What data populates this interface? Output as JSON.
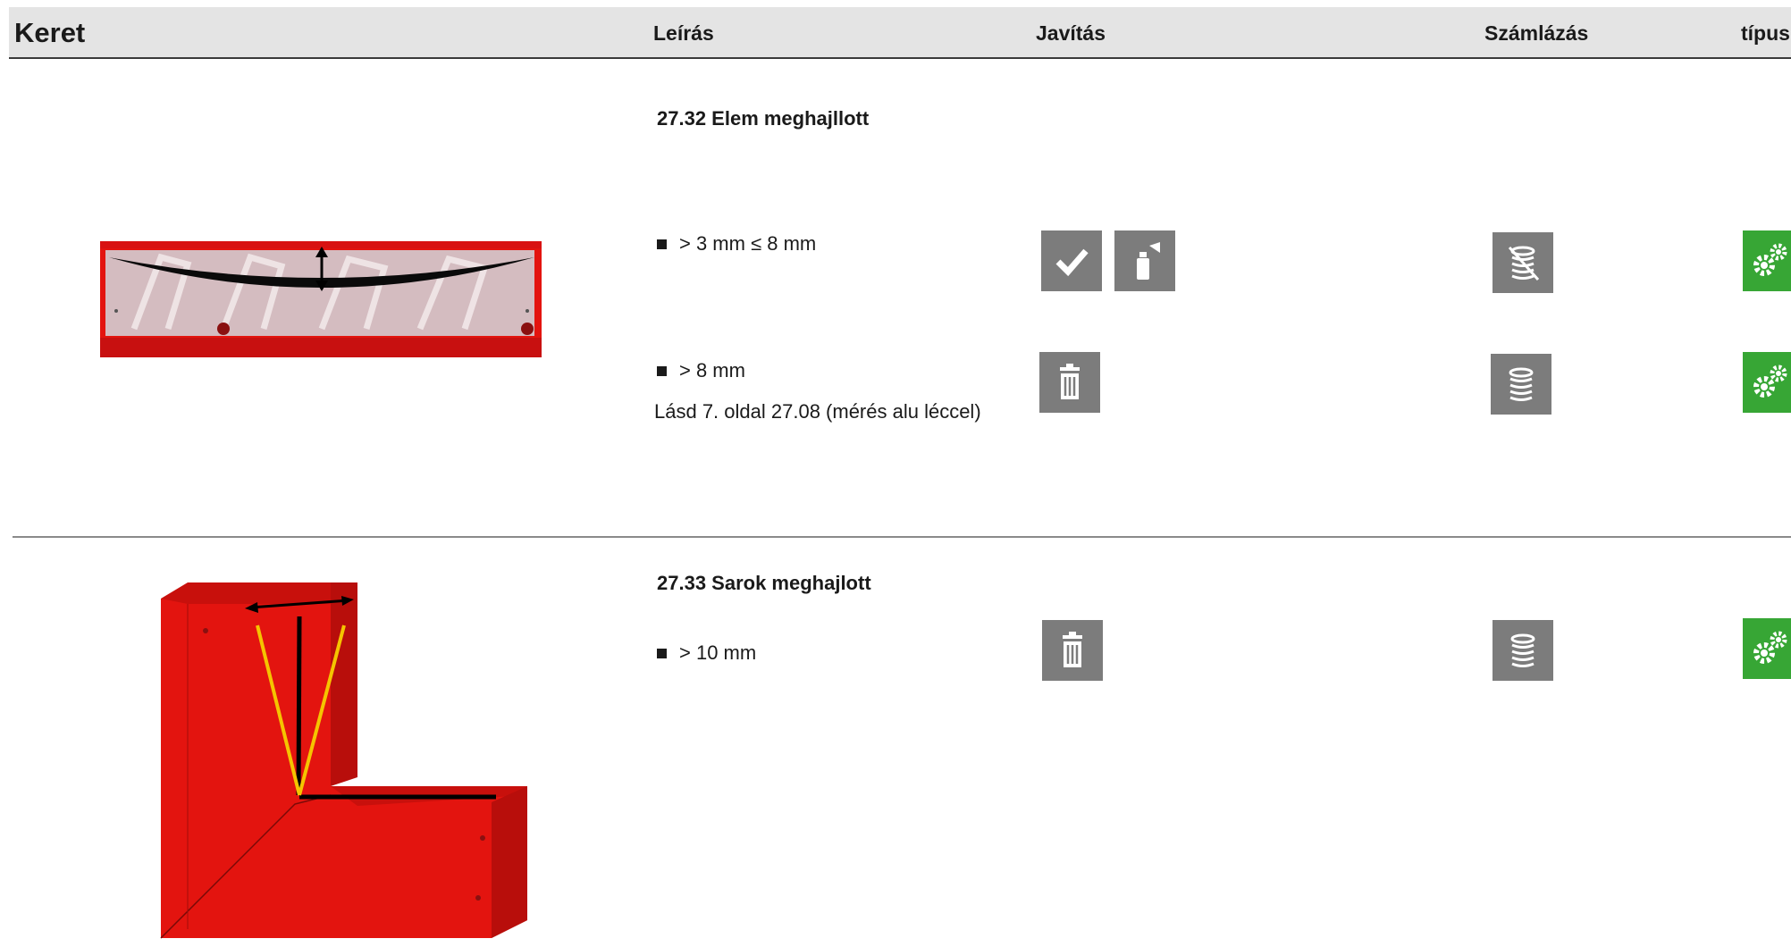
{
  "header": {
    "title": "Keret",
    "columns": [
      "Leírás",
      "Javítás",
      "Számlázás",
      "típus"
    ]
  },
  "sections": [
    {
      "title": "27.32 Elem meghajllott",
      "rows": [
        {
          "condition": "> 3 mm ≤ 8 mm",
          "repair_icons": [
            "checkmark-icon",
            "spray-can-icon"
          ],
          "billing_icon": "coins-crossed-icon",
          "type_icon": "gears-icon"
        },
        {
          "condition": "> 8 mm",
          "note": "Lásd 7. oldal 27.08 (mérés alu léccel)",
          "repair_icons": [
            "trash-icon"
          ],
          "billing_icon": "coins-icon",
          "type_icon": "gears-icon"
        }
      ]
    },
    {
      "title": "27.33 Sarok meghajlott",
      "rows": [
        {
          "condition": "> 10 mm",
          "repair_icons": [
            "trash-icon"
          ],
          "billing_icon": "coins-icon",
          "type_icon": "gears-icon"
        }
      ]
    }
  ],
  "colors": {
    "header_bg": "#e4e4e4",
    "icon_gray": "#7c7c7c",
    "icon_green": "#37a635",
    "frame_red": "#e3140f",
    "marker_yellow": "#f5c400"
  }
}
